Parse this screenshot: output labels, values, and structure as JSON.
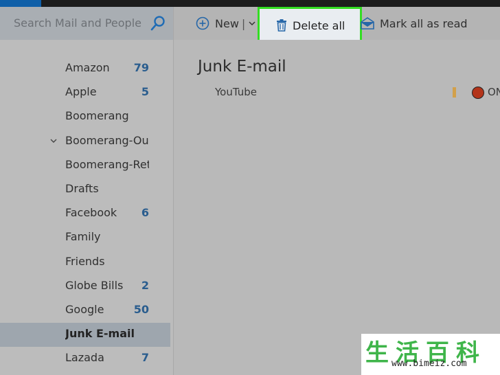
{
  "search": {
    "placeholder": "Search Mail and People"
  },
  "toolbar": {
    "new_label": "New",
    "separator": "|",
    "delete_all_label": "Delete all",
    "mark_all_read_label": "Mark all as read"
  },
  "folders": [
    {
      "name": "Amazon",
      "count": "79"
    },
    {
      "name": "Apple",
      "count": "5"
    },
    {
      "name": "Boomerang",
      "count": ""
    },
    {
      "name": "Boomerang-Outb",
      "count": ""
    },
    {
      "name": "Boomerang-Retur",
      "count": ""
    },
    {
      "name": "Drafts",
      "count": ""
    },
    {
      "name": "Facebook",
      "count": "6"
    },
    {
      "name": "Family",
      "count": ""
    },
    {
      "name": "Friends",
      "count": ""
    },
    {
      "name": "Globe Bills",
      "count": "2"
    },
    {
      "name": "Google",
      "count": "50"
    },
    {
      "name": "Junk E-mail",
      "count": ""
    },
    {
      "name": "Lazada",
      "count": "7"
    }
  ],
  "content": {
    "folder_title": "Junk E-mail",
    "messages": [
      {
        "sender": "YouTube",
        "category": "ON"
      }
    ]
  },
  "watermark": {
    "chars": "生活百科",
    "url": "www.bimeiz.com"
  },
  "colors": {
    "highlight_border": "#33dd22",
    "count_blue": "#2a5d8e",
    "unread_dot": "#b3341a",
    "flag": "#d2a04a"
  }
}
